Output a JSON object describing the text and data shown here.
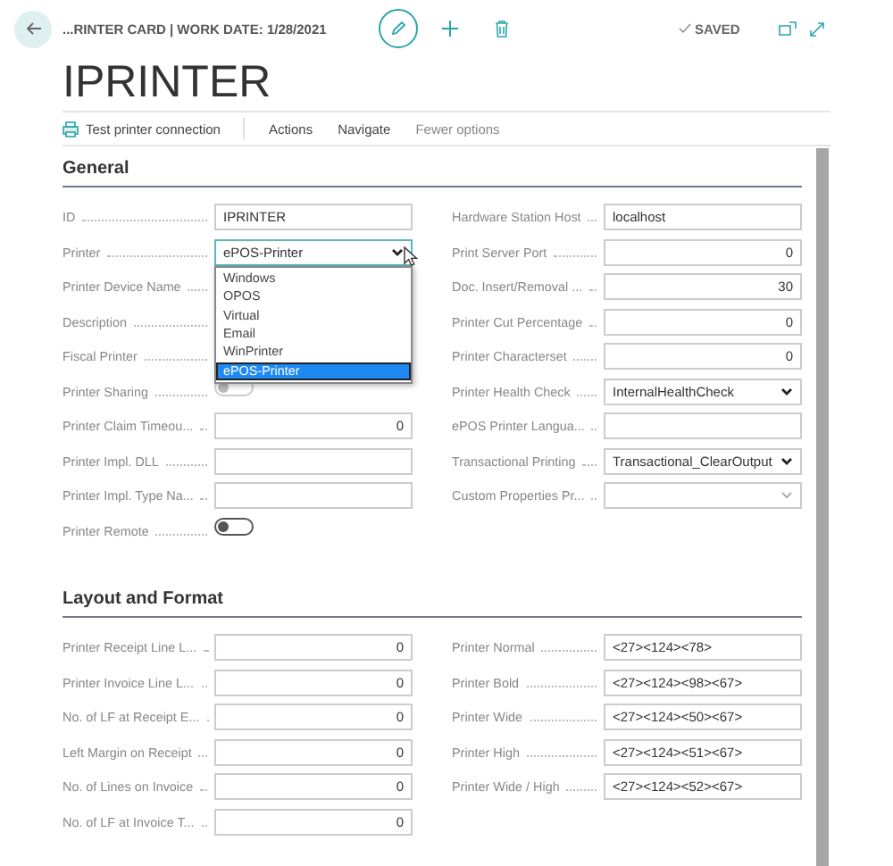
{
  "header": {
    "breadcrumb": "...RINTER CARD | WORK DATE: 1/28/2021",
    "title": "IPRINTER",
    "status": "SAVED"
  },
  "actions": [
    {
      "label": "Test printer connection",
      "kind": "command"
    },
    {
      "label": "Actions",
      "kind": "menu"
    },
    {
      "label": "Navigate",
      "kind": "menu"
    },
    {
      "label": "Fewer options",
      "kind": "menu"
    }
  ],
  "sections": [
    {
      "title": "General",
      "left": [
        {
          "label": "ID",
          "kind": "text",
          "value": "IPRINTER"
        },
        {
          "label": "Printer",
          "kind": "select",
          "value": "ePOS-Printer",
          "open": true,
          "options": [
            {
              "label": "Windows",
              "selected": false
            },
            {
              "label": "OPOS",
              "selected": false
            },
            {
              "label": "Virtual",
              "selected": false
            },
            {
              "label": "Email",
              "selected": false
            },
            {
              "label": "WinPrinter",
              "selected": false
            },
            {
              "label": "ePOS-Printer",
              "selected": true
            }
          ]
        },
        {
          "label": "Printer Device Name",
          "kind": "covered"
        },
        {
          "label": "Description",
          "kind": "covered"
        },
        {
          "label": "Fiscal Printer",
          "kind": "covered"
        },
        {
          "label": "Printer Sharing",
          "kind": "toggle",
          "on": false,
          "disabled": true
        },
        {
          "label": "Printer Claim Timeou...",
          "kind": "number",
          "value": "0"
        },
        {
          "label": "Printer Impl. DLL",
          "kind": "text"
        },
        {
          "label": "Printer Impl. Type Na...",
          "kind": "text"
        },
        {
          "label": "Printer Remote",
          "kind": "toggle",
          "on": false,
          "disabled": false
        }
      ],
      "right": [
        {
          "label": "Hardware Station Host",
          "kind": "text",
          "value": "localhost"
        },
        {
          "label": "Print Server Port",
          "kind": "number",
          "value": "0"
        },
        {
          "label": "Doc. Insert/Removal ...",
          "kind": "number",
          "value": "30"
        },
        {
          "label": "Printer Cut Percentage",
          "kind": "number",
          "value": "0"
        },
        {
          "label": "Printer Characterset",
          "kind": "number",
          "value": "0"
        },
        {
          "label": "Printer Health Check",
          "kind": "select",
          "value": "InternalHealthCheck",
          "open": false
        },
        {
          "label": "ePOS Printer Langua...",
          "kind": "text"
        },
        {
          "label": "Transactional Printing",
          "kind": "select",
          "value": "Transactional_ClearOutput",
          "open": false
        },
        {
          "label": "Custom Properties Pr...",
          "kind": "lookup"
        }
      ]
    },
    {
      "title": "Layout and Format",
      "left": [
        {
          "label": "Printer Receipt Line L...",
          "kind": "number",
          "value": "0"
        },
        {
          "label": "Printer Invoice Line L...",
          "kind": "number",
          "value": "0"
        },
        {
          "label": "No. of LF at Receipt E...",
          "kind": "number",
          "value": "0"
        },
        {
          "label": "Left Margin on Receipt",
          "kind": "number",
          "value": "0"
        },
        {
          "label": "No. of Lines on Invoice",
          "kind": "number",
          "value": "0"
        },
        {
          "label": "No. of LF at Invoice T...",
          "kind": "number",
          "value": "0"
        }
      ],
      "right": [
        {
          "label": "Printer Normal",
          "kind": "text",
          "value": "<27><124><78>"
        },
        {
          "label": "Printer Bold",
          "kind": "text",
          "value": "<27><124><98><67>"
        },
        {
          "label": "Printer Wide",
          "kind": "text",
          "value": "<27><124><50><67>"
        },
        {
          "label": "Printer High",
          "kind": "text",
          "value": "<27><124><51><67>"
        },
        {
          "label": "Printer Wide / High",
          "kind": "text",
          "value": "<27><124><52><67>"
        }
      ]
    }
  ]
}
